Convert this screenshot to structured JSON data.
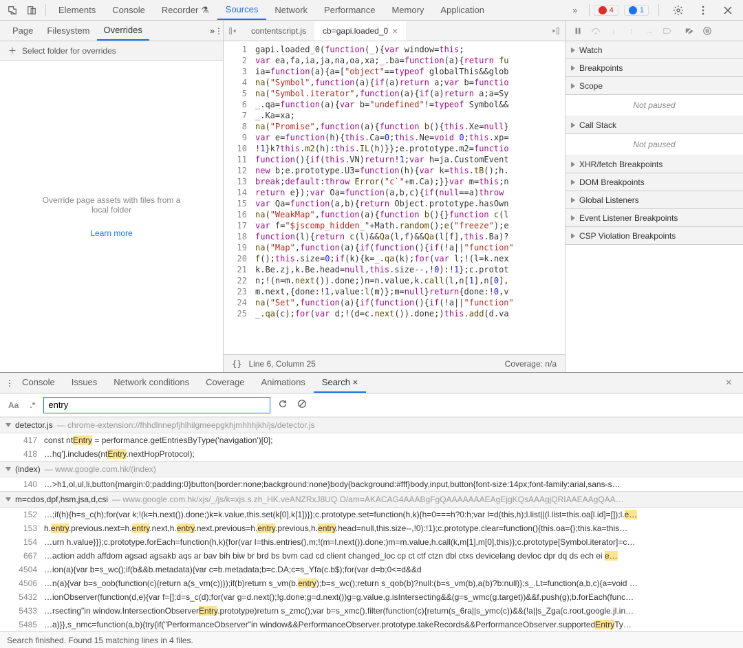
{
  "topTabs": [
    "Elements",
    "Console",
    "Recorder",
    "Sources",
    "Network",
    "Performance",
    "Memory",
    "Application"
  ],
  "topActive": "Sources",
  "errorCount": "4",
  "infoCount": "1",
  "leftTabs": [
    "Page",
    "Filesystem",
    "Overrides"
  ],
  "leftActive": "Overrides",
  "overrides": {
    "add": "Select folder for overrides",
    "msg1": "Override page assets with files from a",
    "msg2": "local folder",
    "learn": "Learn more"
  },
  "fileTabs": [
    {
      "label": "contentscript.js",
      "active": false,
      "close": false
    },
    {
      "label": "cb=gapi.loaded_0",
      "active": true,
      "close": true
    }
  ],
  "codeStatus": {
    "left": "Line 6, Column 25",
    "right": "Coverage: n/a",
    "braces": "{}"
  },
  "rightPanes": [
    "Watch",
    "Breakpoints",
    "Scope",
    "Call Stack",
    "XHR/fetch Breakpoints",
    "DOM Breakpoints",
    "Global Listeners",
    "Event Listener Breakpoints",
    "CSP Violation Breakpoints"
  ],
  "notPaused": "Not paused",
  "drawerTabs": [
    "Console",
    "Issues",
    "Network conditions",
    "Coverage",
    "Animations",
    "Search"
  ],
  "drawerActive": "Search",
  "search": {
    "caseOpt": "Aa",
    "regexOpt": ".*",
    "value": "entry",
    "placeholder": "Search"
  },
  "results": [
    {
      "file": "detector.js",
      "path": "chrome-extension://fhhdlnnepfjhlhilgmeepgkhjmhhhjkh/js/detector.js",
      "expanded": true,
      "lines": [
        {
          "n": "417",
          "pre": "const nt",
          "hl": "Entry",
          "post": " = performance.getEntriesByType('navigation')[0];"
        },
        {
          "n": "418",
          "pre": "…hq'].includes(nt",
          "hl": "Entry",
          "post": ".nextHopProtocol);"
        }
      ]
    },
    {
      "file": "(index)",
      "path": "www.google.com.hk/(index)",
      "expanded": true,
      "lines": [
        {
          "n": "140",
          "pre": "…>h1,ol,ul,li,button{margin:0;padding:0}button{border:none;background:none}body{background:#fff}body,input,button{font-size:14px;font-family:arial,sans-s…",
          "hl": "",
          "post": ""
        }
      ]
    },
    {
      "file": "m=cdos,dpf,hsm,jsa,d,csi",
      "path": "www.google.com.hk/xjs/_/js/k=xjs.s.zh_HK.veANZRxJ8UQ.O/am=AKACAG4AAABgFgQAAAAAAAEAgEjgKQsAAAgjQRIAAEAAgQAA…",
      "expanded": true,
      "lines": [
        {
          "n": "152",
          "pre": "…;if(h){h=s_c(h);for(var k;!(k=h.next()).done;)k=k.value,this.set(k[0],k[1])}};c.prototype.set=function(h,k){h=0===h?0:h;var l=d(this,h);l.list||(l.list=this.oa[l.id]=[]);l.",
          "hl": "e…",
          "post": ""
        },
        {
          "n": "153",
          "pre": "h.",
          "hl": "entry",
          "post": ".previous.next=h.<hl>entry</hl>.next,h.<hl>entry</hl>.next.previous=h.<hl>entry</hl>.previous,h.<hl>entry</hl>.head=null,this.size--,!0):!1};c.prototype.clear=function(){this.oa={};this.ka=this…"
        },
        {
          "n": "154",
          "pre": "…urn h.value}}};c.prototype.forEach=function(h,k){for(var l=this.entries(),m;!(m=l.next()).done;)m=m.value,h.call(k,m[1],m[0],this)};c.prototype[Symbol.iterator]=c…",
          "hl": "",
          "post": ""
        },
        {
          "n": "667",
          "pre": "…action addh affdom agsad agsakb aqs ar bav bih biw br brd bs bvm cad cd client changed_loc cp ct ctf ctzn dbl ctxs devicelang devloc dpr dq ds ech ei ",
          "hl": "e…",
          "post": ""
        },
        {
          "n": "4504",
          "pre": "…ion(a){var b=s_wc();if(b&&b.metadata){var c=b.metadata;b=c.DA;c=s_Yfa(c.b$);for(var d=b;0<=d&&d<c.length;--d){var e=s_cfa(s_Xfa.get(String(c[d])));if(e&…",
          "hl": "",
          "post": ""
        },
        {
          "n": "4506",
          "pre": "…n(a){var b=s_oob(function(c){return a(s_vm(c))});if(b)return s_vm(b.",
          "hl": "entry",
          "post": ");b=s_wc();return s_qob(b)?null:(b=s_vm(b),a(b)?b:null)};s_.Lt=function(a,b,c){a=void …"
        },
        {
          "n": "5432",
          "pre": "…ionObserver(function(d,e){var f=[];d=s_c(d);for(var g=d.next();!g.done;g=d.next())g=g.value,g.isIntersecting&&(g=s_wmc(g.target))&&f.push(g);b.forEach(func…",
          "hl": "",
          "post": ""
        },
        {
          "n": "5433",
          "pre": "…rsecting\"in window.IntersectionObserver",
          "hl": "Entry",
          "post": ".prototype)return s_zmc();var b=s_xmc().filter(function(c){return(s_6ra||s_ymc(c))&&(!a||s_Zga(c.root,google.jl.in…"
        },
        {
          "n": "5485",
          "pre": "…a)}},s_nmc=function(a,b){try{if(\"PerformanceObserver\"in window&&PerformanceObserver.prototype.takeRecords&&PerformanceObserver.supported",
          "hl": "Entry",
          "post": "Ty…"
        }
      ]
    }
  ],
  "statusBar": "Search finished.  Found 15 matching lines in 4 files.",
  "codeLines": [
    "gapi.loaded_0(<kw>function</kw>(_){<kw>var</kw> window=<kw>this</kw>;",
    "<kw>var</kw> ea,fa,ia,ja,na,oa,xa;_.ba=<kw>function</kw>(a){<kw>return</kw> <fn>fu</fn>",
    "ia=<kw>function</kw>(a){a=[<str>\"object\"</str>==<kw>typeof</kw> globalThis&&glob",
    "<fn>na</fn>(<str>\"Symbol\"</str>,<kw>function</kw>(a){<kw>if</kw>(a)<kw>return</kw> a;<kw>var</kw> b=<kw>functio</kw>",
    "<fn>na</fn>(<str>\"Symbol.iterator\"</str>,<kw>function</kw>(a){<kw>if</kw>(a)<kw>return</kw> a;a=Sy",
    "_.qa=<kw>function</kw>(a){<kw>var</kw> b=<str>\"undefined\"</str>!=<kw>typeof</kw> Symbol&&",
    "_.Ka=xa;",
    "<fn>na</fn>(<str>\"Promise\"</str>,<kw>function</kw>(a){<kw>function</kw> <fn>b</fn>(){<kw>this</kw>.Xe=<kw>null</kw>}",
    "<kw>var</kw> e=<kw>function</kw>(h){<kw>this</kw>.Ca=<num>0</num>;<kw>this</kw>.Ne=<kw>void</kw> <num>0</num>;<kw>this</kw>.xp=",
    "!<num>1</num>}k?<kw>this</kw>.<fn>m2</fn>(h):<kw>this</kw>.<fn>IL</fn>(h)}};e.prototype.m2=<kw>functio</kw>",
    "<kw>function</kw>(){<kw>if</kw>(<kw>this</kw>.VN)<kw>return</kw>!<num>1</num>;<kw>var</kw> h=ja.CustomEvent",
    "<kw>new</kw> b;e.prototype.U3=<kw>function</kw>(h){<kw>var</kw> k=<kw>this</kw>.<fn>tB</fn>();h.",
    "<kw>break</kw>;<kw>default</kw>:<kw>throw</kw> <fn>Error</fn>(<str>\"c`\"</str>+m.Ca);}}<kw>var</kw> m=<kw>this</kw>;n",
    "<kw>return</kw> e});<kw>var</kw> Oa=<kw>function</kw>(a,b,c){<kw>if</kw>(<kw>null</kw>==a)<kw>throw</kw> ",
    "<kw>var</kw> Qa=<kw>function</kw>(a,b){<kw>return</kw> Object.prototype.hasOwn",
    "<fn>na</fn>(<str>\"WeakMap\"</str>,<kw>function</kw>(a){<kw>function</kw> <fn>b</fn>(){}<kw>function</kw> <fn>c</fn>(l",
    "<kw>var</kw> f=<str>\"$jscomp_hidden_\"</str>+Math.<fn>random</fn>();<fn>e</fn>(<str>\"freeze\"</str>);e",
    "<kw>function</kw>(l){<kw>return</kw> <fn>c</fn>(l)&&<fn>Qa</fn>(l,f)&&<fn>Qa</fn>(l[f],<kw>this</kw>.Ba)?",
    "<fn>na</fn>(<str>\"Map\"</str>,<kw>function</kw>(a){<kw>if</kw>(<kw>function</kw>(){<kw>if</kw>(!a||<str>\"function\"</str>",
    "<fn>f</fn>();<kw>this</kw>.size=<num>0</num>;<kw>if</kw>(k){k=_.<fn>qa</fn>(k);<kw>for</kw>(<kw>var</kw> l;!(l=k.nex",
    "k.Be.zj,k.Be.head=<kw>null</kw>,<kw>this</kw>.size--,!<num>0</num>):!<num>1</num>};c.protot",
    "n;!(n=m.<fn>next</fn>()).done;)n=n.value,k.<fn>call</fn>(l,n[<num>1</num>],n[<num>0</num>],",
    "m.next,{done:!<num>1</num>,value:<fn>l</fn>(m)};m=<kw>null</kw>}<kw>return</kw>{done:!<num>0</num>,v",
    "<fn>na</fn>(<str>\"Set\"</str>,<kw>function</kw>(a){<kw>if</kw>(<kw>function</kw>(){<kw>if</kw>(!a||<str>\"function\"</str>",
    "_.<fn>qa</fn>(c);<kw>for</kw>(<kw>var</kw> d;!(d=c.<fn>next</fn>()).done;)<kw>this</kw>.<fn>add</fn>(d.va"
  ]
}
